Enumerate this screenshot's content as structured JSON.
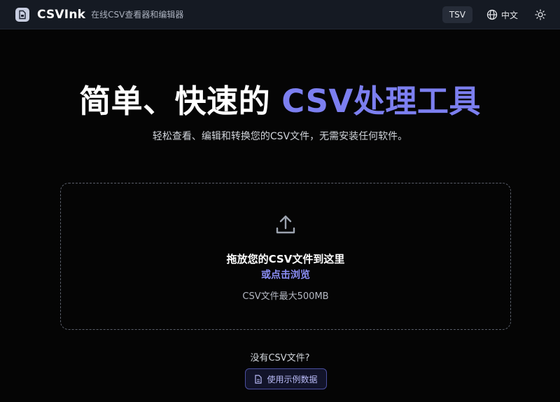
{
  "header": {
    "brand_name": "CSVInk",
    "tagline": "在线CSV查看器和编辑器",
    "tsv_label": "TSV",
    "language_label": "中文"
  },
  "hero": {
    "title_main": "简单、快速的",
    "title_accent": "CSV处理工具",
    "subtitle": "轻松查看、编辑和转换您的CSV文件，无需安装任何软件。"
  },
  "dropzone": {
    "main_text": "拖放您的CSV文件到这里",
    "browse_text": "或点击浏览",
    "hint_text": "CSV文件最大500MB"
  },
  "sample": {
    "prompt": "没有CSV文件?",
    "button_label": "使用示例数据"
  },
  "icons": {
    "logo": "csv-file-logo-icon",
    "language": "globe-icon",
    "theme": "sun-icon",
    "upload": "upload-icon",
    "sample": "file-icon"
  },
  "colors": {
    "accent": "#7c7ff0",
    "background": "#050505",
    "header_bg": "#151a23"
  }
}
